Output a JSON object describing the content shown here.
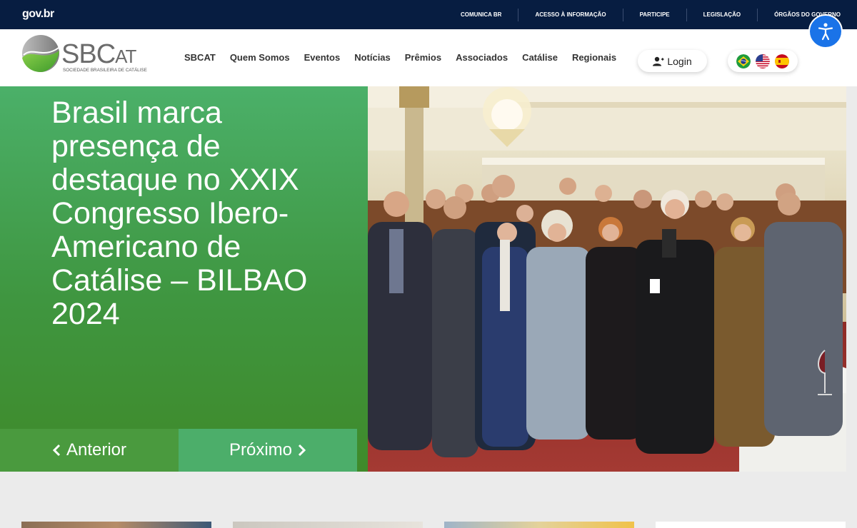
{
  "govbar": {
    "logo": "gov.br",
    "links": [
      "COMUNICA BR",
      "ACESSO À INFORMAÇÃO",
      "PARTICIPE",
      "LEGISLAÇÃO",
      "ÓRGÃOS DO GOVERNO"
    ]
  },
  "header": {
    "brand_main": "SBC",
    "brand_small": "AT",
    "brand_sub": "SOCIEDADE BRASILEIRA DE CATÁLISE",
    "nav": [
      "SBCAT",
      "Quem Somos",
      "Eventos",
      "Notícias",
      "Prêmios",
      "Associados",
      "Catálise",
      "Regionais"
    ],
    "login_label": "Login",
    "languages": [
      "user-icon",
      "flag-brazil-icon",
      "flag-usa-icon",
      "flag-spain-icon"
    ]
  },
  "hero": {
    "title": "Brasil marca presença de destaque no XXIX Congresso Ibero-Americano de Catálise – BILBAO 2024",
    "prev_label": "Anterior",
    "next_label": "Próximo"
  },
  "colors": {
    "govbar": "#071d41",
    "accent_green": "#4bb069",
    "accessibility": "#1a73e8"
  }
}
